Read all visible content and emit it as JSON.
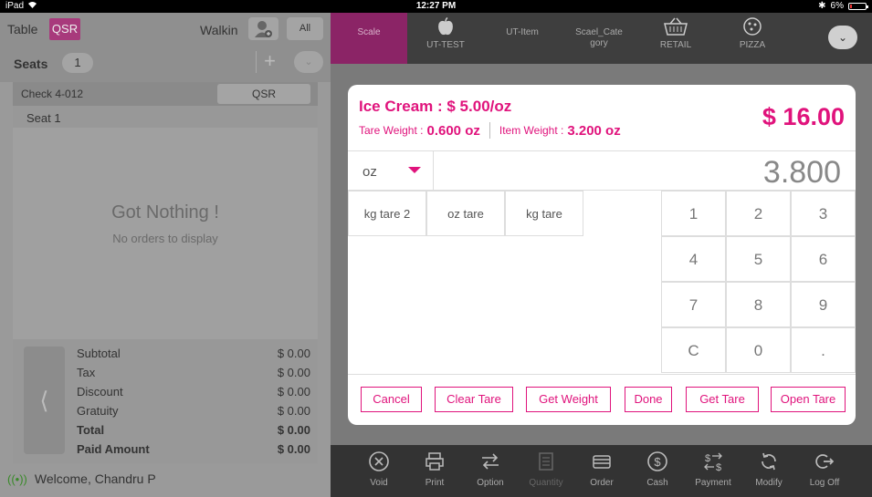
{
  "status_bar": {
    "device": "iPad",
    "time": "12:27 PM",
    "battery": "6%",
    "bluetooth_icon": "bluetooth-icon",
    "wifi_icon": "wifi-icon"
  },
  "left_panel": {
    "table_label": "Table",
    "table_badge": "QSR",
    "customer": "Walkin",
    "all_button": "All",
    "seats_label": "Seats",
    "seats_count": "1",
    "check_label": "Check  4-012",
    "check_type": "QSR",
    "seat_label": "Seat 1",
    "empty_title": "Got Nothing !",
    "empty_subtitle": "No orders to display",
    "totals": [
      {
        "label": "Subtotal",
        "value": "$ 0.00",
        "bold": false
      },
      {
        "label": "Tax",
        "value": "$ 0.00",
        "bold": false
      },
      {
        "label": "Discount",
        "value": "$ 0.00",
        "bold": false
      },
      {
        "label": "Gratuity",
        "value": "$ 0.00",
        "bold": false
      },
      {
        "label": "Total",
        "value": "$ 0.00",
        "bold": true
      },
      {
        "label": "Paid Amount",
        "value": "$ 0.00",
        "bold": true
      }
    ],
    "welcome": "Welcome, Chandru P"
  },
  "categories": [
    {
      "label": "Scale",
      "icon": "",
      "active": true
    },
    {
      "label": "UT-TEST",
      "icon": "apple-icon",
      "active": false
    },
    {
      "label": "UT-Item",
      "icon": "",
      "active": false
    },
    {
      "label": "Scael_Category",
      "icon": "",
      "active": false
    },
    {
      "label": "RETAIL",
      "icon": "basket-icon",
      "active": false
    },
    {
      "label": "PIZZA",
      "icon": "pizza-icon",
      "active": false
    }
  ],
  "dialog": {
    "title": "Ice Cream : $ 5.00/oz",
    "tare_weight_label": "Tare Weight :",
    "tare_weight_value": "0.600 oz",
    "item_weight_label": "Item Weight :",
    "item_weight_value": "3.200 oz",
    "price": "$ 16.00",
    "unit": "oz",
    "weight_input": "3.800",
    "tare_buttons": [
      "kg tare 2",
      "oz tare",
      "kg tare"
    ],
    "keypad": [
      "1",
      "2",
      "3",
      "4",
      "5",
      "6",
      "7",
      "8",
      "9",
      "C",
      "0",
      "."
    ],
    "actions": [
      "Cancel",
      "Clear Tare",
      "Get Weight",
      "Done",
      "Get Tare",
      "Open Tare"
    ]
  },
  "toolbar": [
    {
      "label": "Void",
      "icon": "void-icon",
      "enabled": true
    },
    {
      "label": "Print",
      "icon": "printer-icon",
      "enabled": true
    },
    {
      "label": "Option",
      "icon": "option-icon",
      "enabled": true
    },
    {
      "label": "Quantity",
      "icon": "quantity-icon",
      "enabled": false
    },
    {
      "label": "Order",
      "icon": "order-icon",
      "enabled": true
    },
    {
      "label": "Cash",
      "icon": "cash-icon",
      "enabled": true
    },
    {
      "label": "Payment",
      "icon": "payment-icon",
      "enabled": true
    },
    {
      "label": "Modify",
      "icon": "modify-icon",
      "enabled": true
    },
    {
      "label": "Log Off",
      "icon": "logoff-icon",
      "enabled": true
    }
  ],
  "colors": {
    "accent": "#e0137c",
    "category_active": "#8b2466"
  }
}
